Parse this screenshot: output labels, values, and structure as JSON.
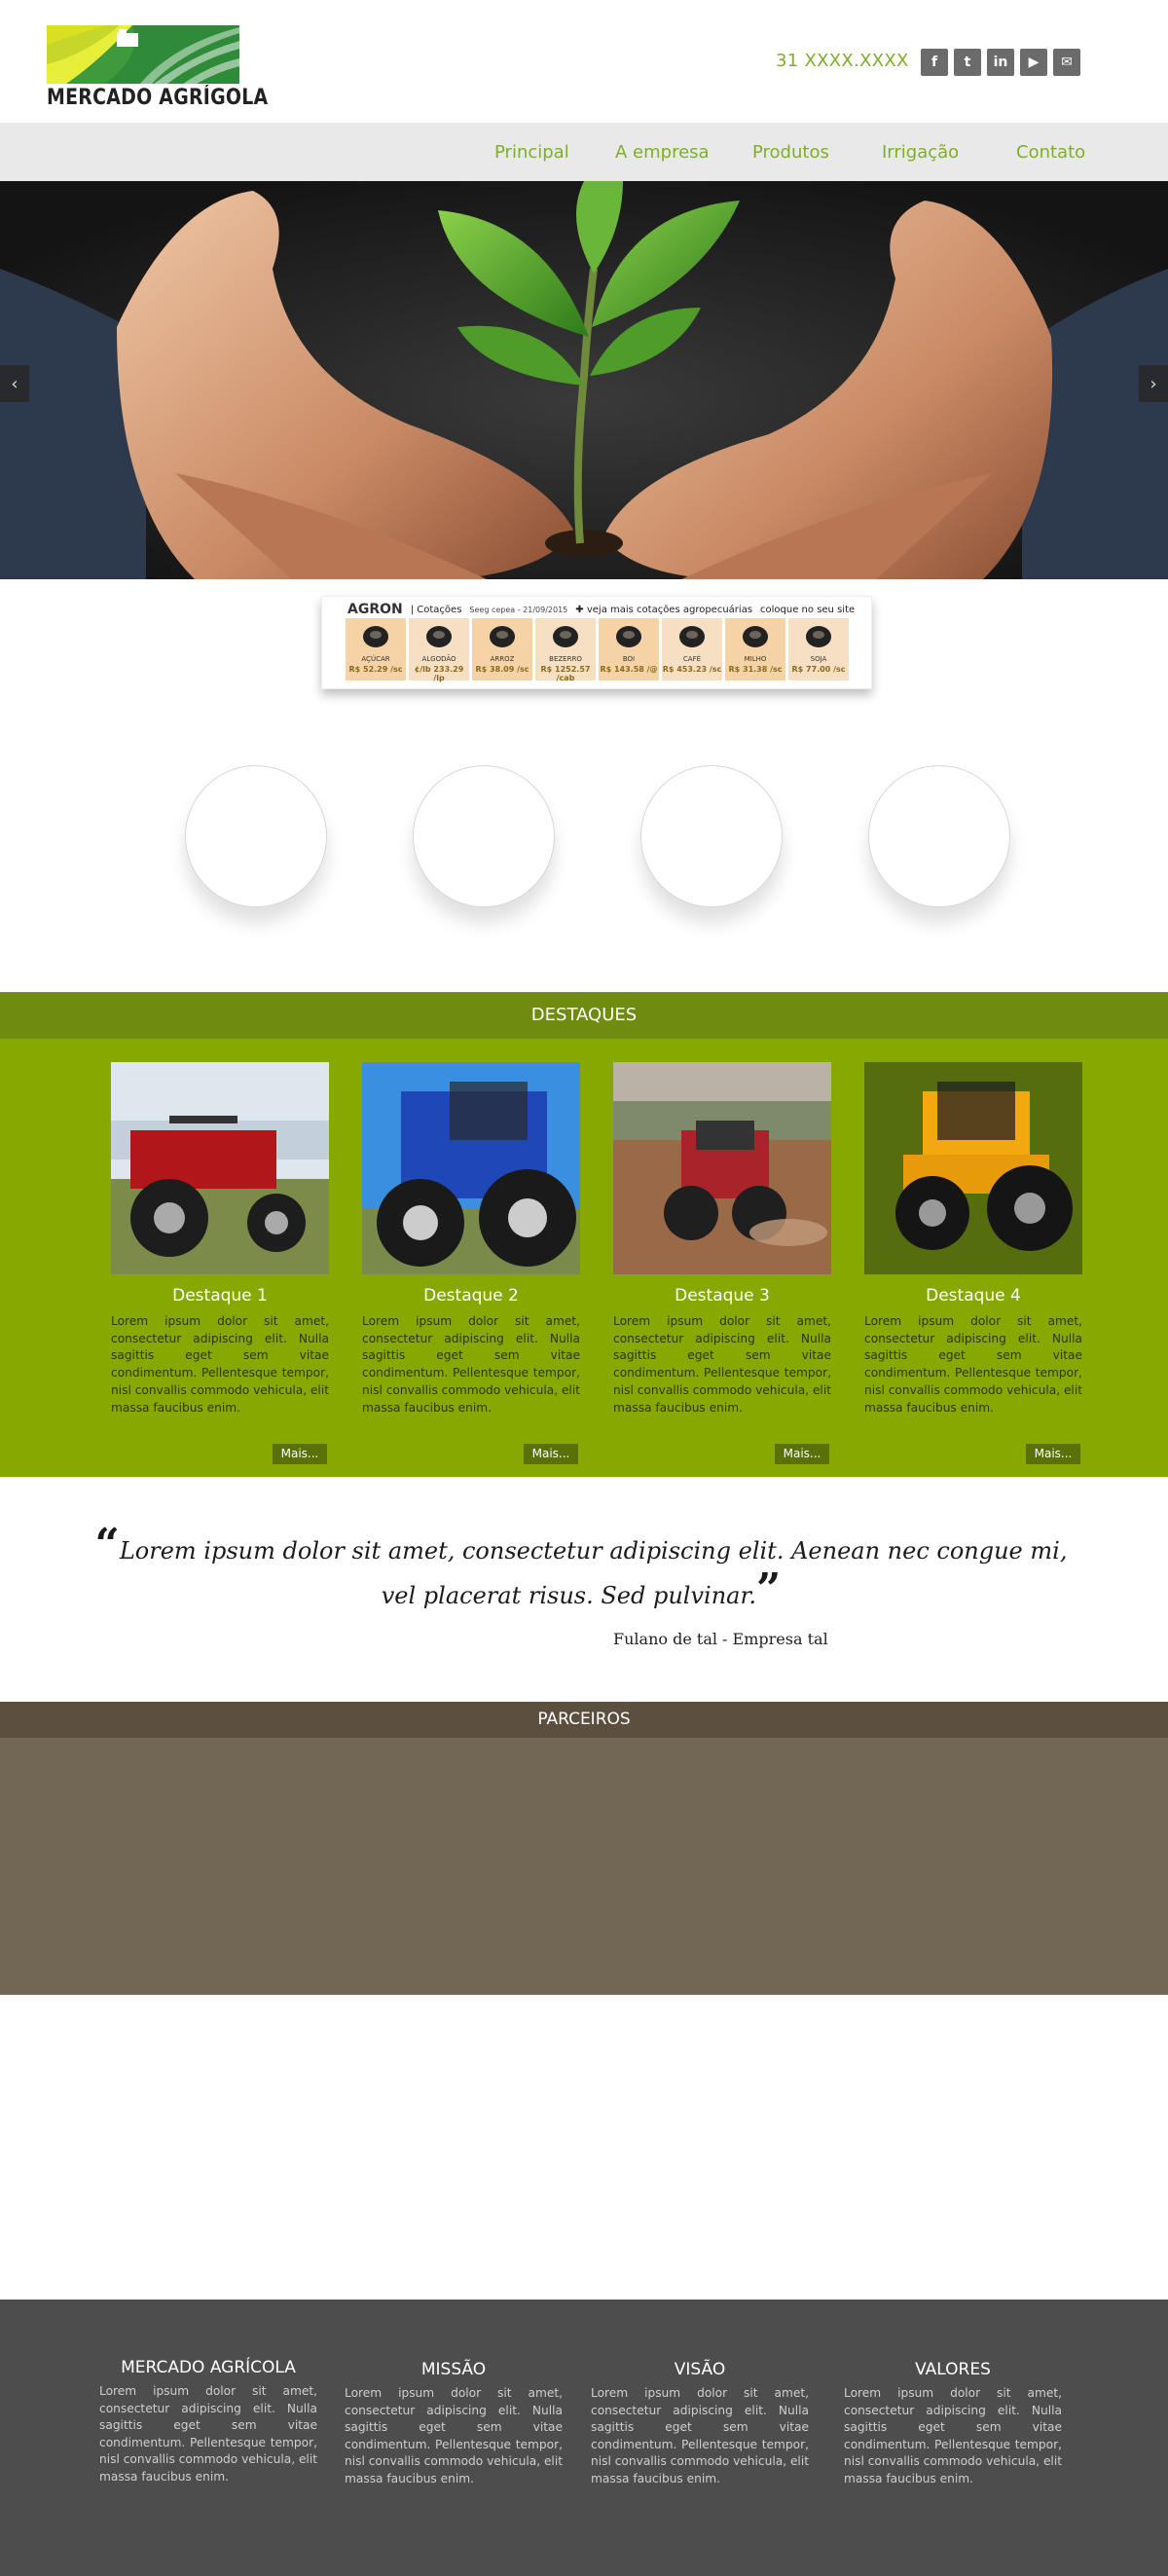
{
  "header": {
    "logo_text": "MERCADO AGRÍGOLA",
    "phone": "31 XXXX.XXXX",
    "social": [
      {
        "icon": "facebook-icon",
        "glyph": "f"
      },
      {
        "icon": "twitter-icon",
        "glyph": "t"
      },
      {
        "icon": "linkedin-icon",
        "glyph": "in"
      },
      {
        "icon": "youtube-icon",
        "glyph": "▶"
      },
      {
        "icon": "mail-icon",
        "glyph": "✉"
      }
    ]
  },
  "nav": {
    "items": [
      "Principal",
      "A empresa",
      "Produtos",
      "Irrigação",
      "Contato"
    ]
  },
  "hero": {
    "prev_glyph": "‹",
    "next_glyph": "›"
  },
  "quotes_widget": {
    "brand": "AGRON",
    "section": "| Cotações",
    "date": "Seeg cepea - 21/09/2015",
    "more_link": "✚ veja mais cotações agropecuárias",
    "site_link": "coloque no seu site",
    "items": [
      {
        "name": "AÇÚCAR",
        "price": "R$ 52.29 /sc"
      },
      {
        "name": "ALGODÃO",
        "price": "¢/lb 233.29 /lp"
      },
      {
        "name": "ARROZ",
        "price": "R$ 38.09 /sc"
      },
      {
        "name": "BEZERRO",
        "price": "R$ 1252.57 /cab"
      },
      {
        "name": "BOI",
        "price": "R$ 143.58 /@"
      },
      {
        "name": "CAFÉ",
        "price": "R$ 453.23 /sc"
      },
      {
        "name": "MILHO",
        "price": "R$ 31.38 /sc"
      },
      {
        "name": "SOJA",
        "price": "R$ 77.00 /sc"
      }
    ]
  },
  "destaques": {
    "heading": "DESTAQUES",
    "cards": [
      {
        "title": "Destaque 1",
        "text": "Lorem ipsum dolor sit amet, consectetur adipiscing elit. Nulla sagittis eget sem vitae condimentum. Pellentesque tempor, nisl convallis commodo vehicula, elit massa faucibus enim.",
        "more": "Mais..."
      },
      {
        "title": "Destaque 2",
        "text": "Lorem ipsum dolor sit amet, consectetur adipiscing elit. Nulla sagittis eget sem vitae condimentum. Pellentesque tempor, nisl convallis commodo vehicula, elit massa faucibus enim.",
        "more": "Mais..."
      },
      {
        "title": "Destaque 3",
        "text": "Lorem ipsum dolor sit amet, consectetur adipiscing elit. Nulla sagittis eget sem vitae condimentum. Pellentesque tempor, nisl convallis commodo vehicula, elit massa faucibus enim.",
        "more": "Mais..."
      },
      {
        "title": "Destaque 4",
        "text": "Lorem ipsum dolor sit amet, consectetur adipiscing elit. Nulla sagittis eget sem vitae condimentum. Pellentesque tempor, nisl convallis commodo vehicula, elit massa faucibus enim.",
        "more": "Mais..."
      }
    ]
  },
  "testimonial": {
    "text": "Lorem ipsum dolor sit amet, consectetur adipiscing elit. Aenean nec congue mi, vel placerat risus. Sed pulvinar.",
    "author": "Fulano de tal - Empresa tal"
  },
  "parceiros": {
    "heading": "PARCEIROS"
  },
  "footer": {
    "columns": [
      {
        "title": "MERCADO AGRÍCOLA",
        "text": "Lorem ipsum dolor sit amet, consectetur adipiscing elit. Nulla sagittis eget sem vitae condimentum. Pellentesque tempor, nisl convallis commodo vehicula, elit massa faucibus enim."
      },
      {
        "title": "MISSÃO",
        "text": "Lorem ipsum dolor sit amet, consectetur adipiscing elit. Nulla sagittis eget sem vitae condimentum. Pellentesque tempor, nisl convallis commodo vehicula, elit massa faucibus enim."
      },
      {
        "title": "VISÃO",
        "text": "Lorem ipsum dolor sit amet, consectetur adipiscing elit. Nulla sagittis eget sem vitae condimentum. Pellentesque tempor, nisl convallis commodo vehicula, elit massa faucibus enim."
      },
      {
        "title": "VALORES",
        "text": "Lorem ipsum dolor sit amet, consectetur adipiscing elit. Nulla sagittis eget sem vitae condimentum. Pellentesque tempor, nisl convallis commodo vehicula, elit massa faucibus enim."
      }
    ]
  },
  "colors": {
    "brand_green": "#7fae2a",
    "destaques_bar": "#6f8b10",
    "destaques_body": "#86a800",
    "parceiros_bar": "#5d4f3f",
    "parceiros_body": "#726655",
    "footer": "#4d4d4d",
    "nav_bg": "#e9e9e9"
  }
}
